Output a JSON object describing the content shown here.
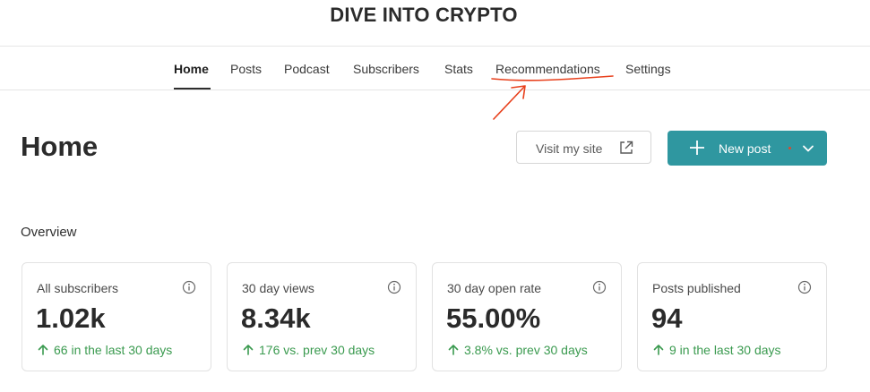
{
  "site": {
    "title": "DIVE INTO CRYPTO"
  },
  "nav": {
    "items": [
      {
        "label": "Home"
      },
      {
        "label": "Posts"
      },
      {
        "label": "Podcast"
      },
      {
        "label": "Subscribers"
      },
      {
        "label": "Stats"
      },
      {
        "label": "Recommendations"
      },
      {
        "label": "Settings"
      }
    ],
    "active": "Home"
  },
  "page": {
    "title": "Home"
  },
  "buttons": {
    "visit_label": "Visit my site",
    "new_post_label": "New post"
  },
  "overview": {
    "title": "Overview",
    "cards": [
      {
        "label": "All subscribers",
        "value": "1.02k",
        "delta": "66 in the last 30 days"
      },
      {
        "label": "30 day views",
        "value": "8.34k",
        "delta": "176 vs. prev 30 days"
      },
      {
        "label": "30 day open rate",
        "value": "55.00%",
        "delta": "3.8% vs. prev 30 days"
      },
      {
        "label": "Posts published",
        "value": "94",
        "delta": "9 in the last 30 days"
      }
    ]
  },
  "colors": {
    "accent": "#2f97a0",
    "positive": "#3a9a4f",
    "annotation": "#e8401c"
  },
  "icons": {
    "external_link": "external-link-icon",
    "plus": "plus-icon",
    "chevron": "chevron-down-icon",
    "info": "info-icon",
    "trend_up": "arrow-up-icon"
  }
}
